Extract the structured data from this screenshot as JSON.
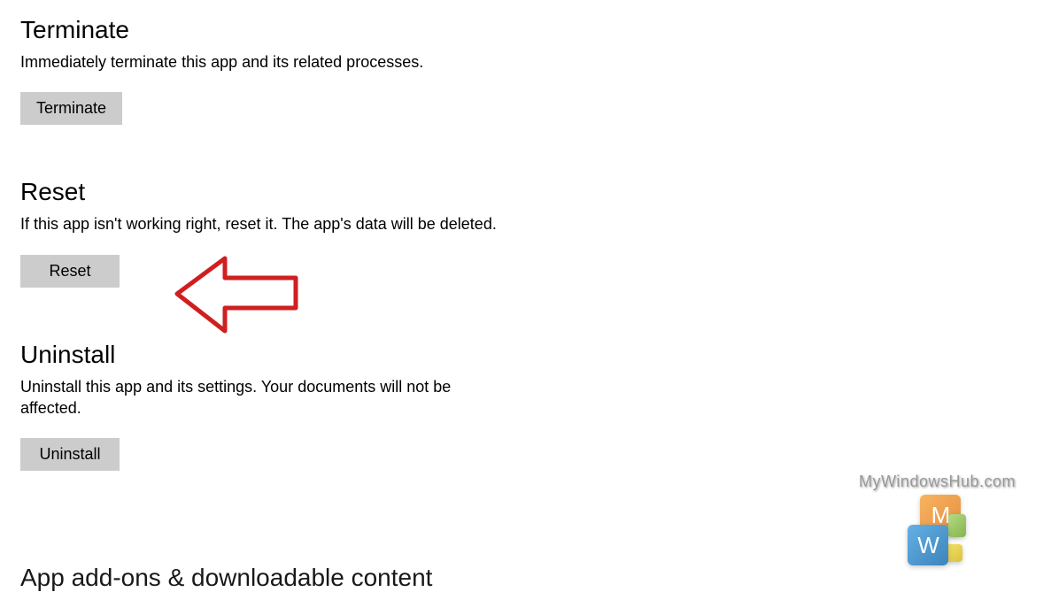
{
  "sections": {
    "terminate": {
      "title": "Terminate",
      "desc": "Immediately terminate this app and its related processes.",
      "button": "Terminate"
    },
    "reset": {
      "title": "Reset",
      "desc": "If this app isn't working right, reset it. The app's data will be deleted.",
      "button": "Reset"
    },
    "uninstall": {
      "title": "Uninstall",
      "desc": "Uninstall this app and its settings. Your documents will not be affected.",
      "button": "Uninstall"
    },
    "addons": {
      "title": "App add-ons & downloadable content"
    }
  },
  "watermark": {
    "text": "MyWindowsHub.com",
    "logo_m": "M",
    "logo_w": "W"
  }
}
